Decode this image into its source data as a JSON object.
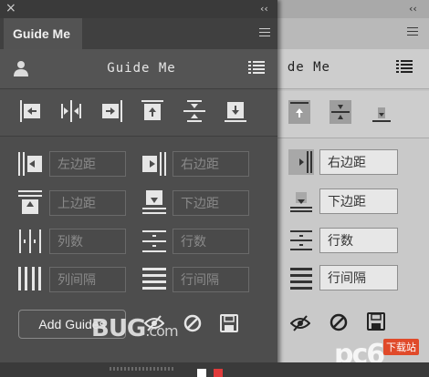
{
  "window": {
    "close_glyph": "×",
    "collapse_glyph": "‹‹"
  },
  "tab": {
    "label": "Guide Me"
  },
  "header": {
    "title": "Guide Me"
  },
  "back_panel": {
    "title": "de Me",
    "fields": [
      "右边距",
      "下边距",
      "行数",
      "行间隔"
    ]
  },
  "fields": {
    "left_margin": "左边距",
    "right_margin": "右边距",
    "top_margin": "上边距",
    "bottom_margin": "下边距",
    "columns": "列数",
    "rows": "行数",
    "column_gutter": "列间隔",
    "row_gutter": "行间隔"
  },
  "footer": {
    "add_guides_label": "Add Guides"
  },
  "watermark": {
    "brand": "BUG",
    "domain": ".com",
    "site": "pc6",
    "badge": "下载站"
  },
  "colors": {
    "panel_dark": "#525252",
    "panel_light": "#c4c4c4",
    "swatch_white": "#ffffff",
    "swatch_red": "#e03a3a"
  },
  "icons": {
    "user": "user-icon",
    "list": "list-icon",
    "eye": "eye-icon",
    "clear": "clear-icon",
    "save": "save-icon"
  }
}
